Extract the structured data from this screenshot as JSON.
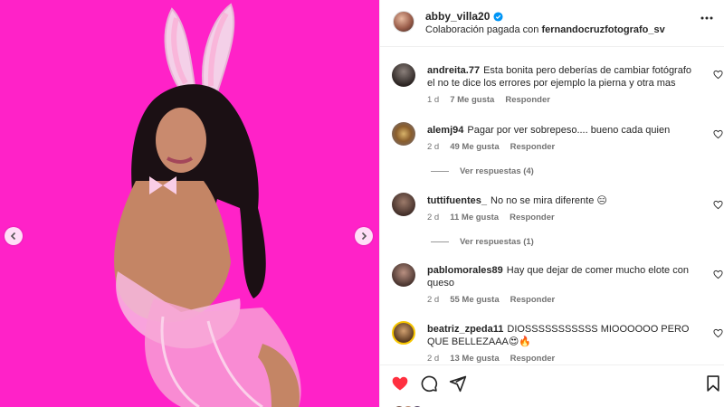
{
  "post": {
    "username": "abby_villa20",
    "collab_prefix": "Colaboración pagada con",
    "collab_user": "fernandocruzfotografo_sv"
  },
  "colors": {
    "media_background": "#ff22c8",
    "heart_red": "#ff3040",
    "verified_blue": "#0095f6",
    "text_primary": "#262626",
    "text_secondary": "#737373"
  },
  "icons": {
    "more": "more-horizontal-icon",
    "like": "heart-icon",
    "comment": "comment-icon",
    "share": "share-icon",
    "save": "bookmark-icon",
    "prev": "chevron-left-icon",
    "next": "chevron-right-icon"
  },
  "comments": [
    {
      "username": "andreita.77",
      "text": "Esta bonita pero deberías de cambiar fotógrafo el no te dice los errores por ejemplo la pierna y otra mas",
      "age": "1 d",
      "likes": "7 Me gusta",
      "reply": "Responder"
    },
    {
      "username": "alemj94",
      "text": "Pagar por ver sobrepeso.... bueno cada quien",
      "age": "2 d",
      "likes": "49 Me gusta",
      "reply": "Responder",
      "view_replies": "Ver respuestas (4)"
    },
    {
      "username": "tuttifuentes_",
      "text": "No no se mira diferente 😑",
      "age": "2 d",
      "likes": "11 Me gusta",
      "reply": "Responder",
      "view_replies": "Ver respuestas (1)"
    },
    {
      "username": "pablomorales89",
      "text": "Hay que dejar de comer mucho elote con queso",
      "age": "2 d",
      "likes": "55 Me gusta",
      "reply": "Responder"
    },
    {
      "username": "beatriz_zpeda11",
      "text": "DIOSSSSSSSSSSS MIOOOOOO PERO QUE BELLEZAAA😍🔥",
      "age": "2 d",
      "likes": "13 Me gusta",
      "reply": "Responder"
    }
  ]
}
